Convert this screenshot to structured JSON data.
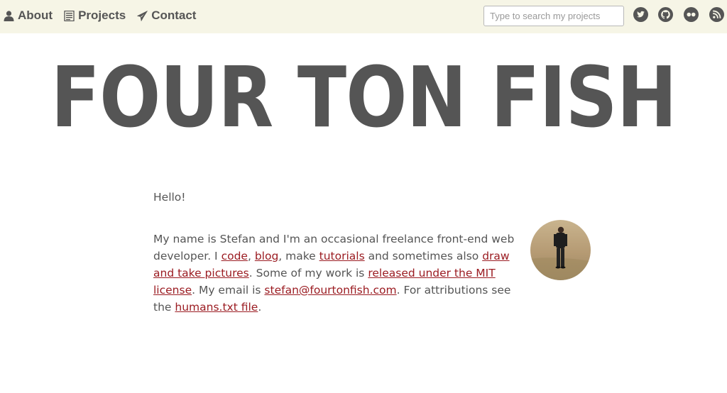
{
  "nav": {
    "items": [
      {
        "label": "About",
        "icon": "user-icon"
      },
      {
        "label": "Projects",
        "icon": "list-icon"
      },
      {
        "label": "Contact",
        "icon": "paper-plane-icon"
      }
    ]
  },
  "search": {
    "placeholder": "Type to search my projects",
    "value": ""
  },
  "social": [
    {
      "icon": "twitter-icon"
    },
    {
      "icon": "github-icon"
    },
    {
      "icon": "flickr-icon"
    },
    {
      "icon": "rss-icon"
    }
  ],
  "header": {
    "title": "FOUR TON FISH"
  },
  "main": {
    "greeting": "Hello!",
    "bio": {
      "t1": "My name is Stefan and I'm an occasional freelance front-end web developer. I ",
      "link_code": "code",
      "t2": ", ",
      "link_blog": "blog",
      "t3": ", make ",
      "link_tutorials": "tutorials",
      "t4": " and sometimes also ",
      "link_draw": "draw and take pictures",
      "t5": ". Some of my work is ",
      "link_license": "released under the MIT license",
      "t6": ". My email is ",
      "link_email": "stefan@fourtonfish.com",
      "t7": ". For attributions see the ",
      "link_humans": "humans.txt file",
      "t8": "."
    }
  },
  "colors": {
    "topbar_bg": "#f6f5e6",
    "text": "#555555",
    "link": "#9b1c22"
  }
}
